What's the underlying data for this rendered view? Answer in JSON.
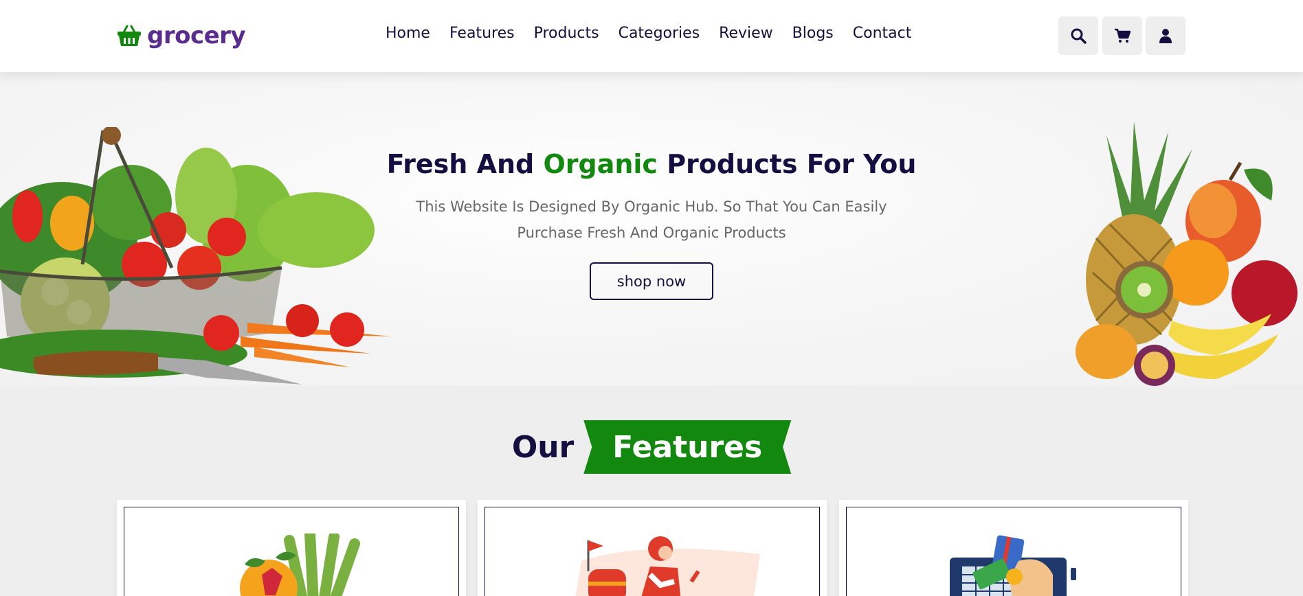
{
  "header": {
    "logo_text": "grocery",
    "nav": [
      "Home",
      "Features",
      "Products",
      "Categories",
      "Review",
      "Blogs",
      "Contact"
    ],
    "icons": [
      "search-icon",
      "cart-icon",
      "user-icon"
    ]
  },
  "hero": {
    "title_pre": "Fresh And ",
    "title_highlight": "Organic",
    "title_post": " Products For You",
    "description": "This Website Is Designed By Organic Hub. So That You Can Easily Purchase Fresh And Organic Products",
    "button_label": "shop now"
  },
  "features": {
    "heading_plain": "Our",
    "heading_highlight": "Features"
  },
  "colors": {
    "primary_dark": "#130f40",
    "accent_green": "#12880f",
    "logo_purple": "#5b2c8f",
    "background": "#eeeeee"
  }
}
